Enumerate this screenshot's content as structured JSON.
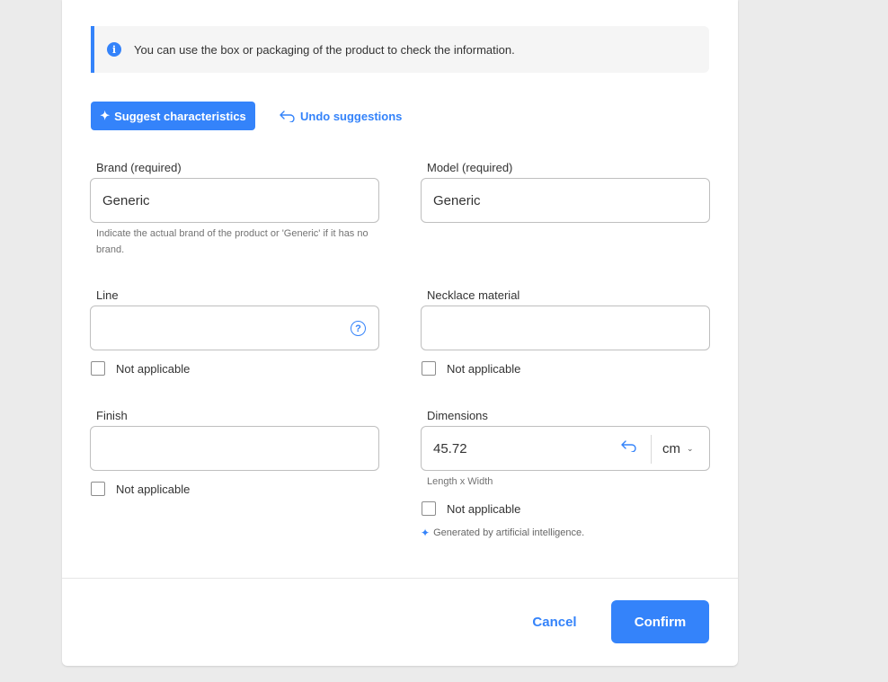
{
  "info_banner": {
    "text": "You can use the box or packaging of the product to check the information.",
    "icon": "info-icon"
  },
  "actions": {
    "suggest_label": "Suggest characteristics",
    "undo_label": "Undo suggestions"
  },
  "fields": {
    "brand": {
      "label": "Brand (required)",
      "value": "Generic",
      "helper": "Indicate the actual brand of the product or 'Generic' if it has no brand."
    },
    "model": {
      "label": "Model (required)",
      "value": "Generic"
    },
    "line": {
      "label": "Line",
      "value": "",
      "not_applicable": "Not applicable"
    },
    "necklace_material": {
      "label": "Necklace material",
      "value": "",
      "not_applicable": "Not applicable"
    },
    "finish": {
      "label": "Finish",
      "value": "",
      "not_applicable": "Not applicable"
    },
    "dimensions": {
      "label": "Dimensions",
      "value": "45.72",
      "unit": "cm",
      "helper": "Length x Width",
      "not_applicable": "Not applicable",
      "ai_note": "Generated by artificial intelligence."
    }
  },
  "footer": {
    "cancel_label": "Cancel",
    "confirm_label": "Confirm"
  },
  "colors": {
    "accent": "#3483fa",
    "background": "#ebebeb"
  }
}
